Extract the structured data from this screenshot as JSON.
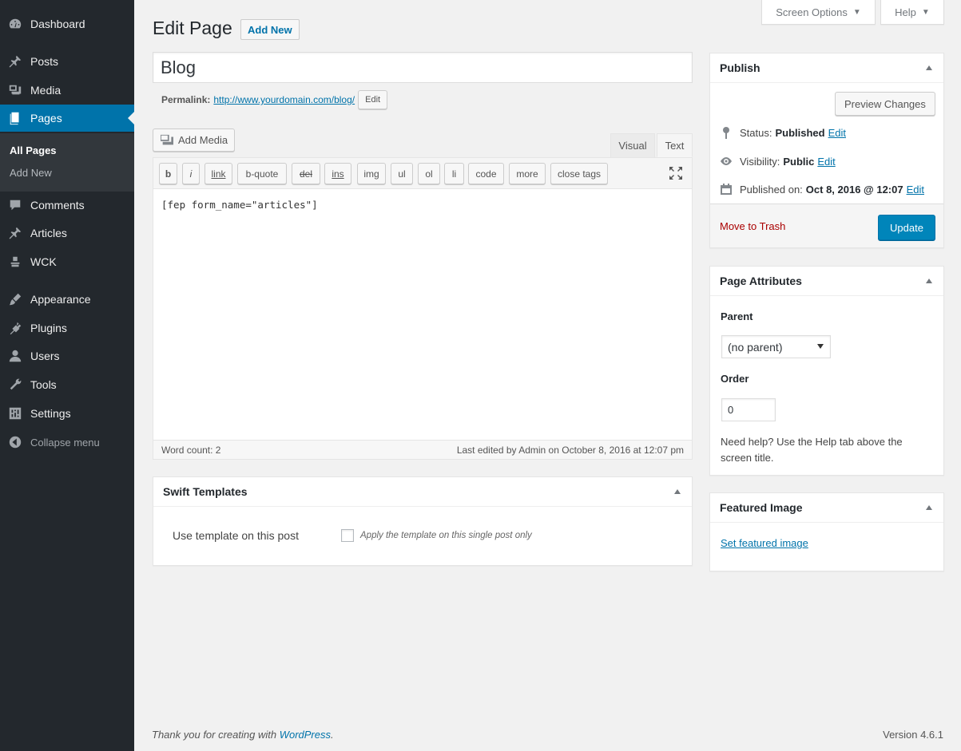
{
  "sidebar": {
    "items": [
      {
        "label": "Dashboard",
        "icon": "dashboard-icon"
      },
      {
        "label": "Posts",
        "icon": "pin-icon"
      },
      {
        "label": "Media",
        "icon": "media-icon"
      },
      {
        "label": "Pages",
        "icon": "pages-icon",
        "current": true
      },
      {
        "label": "Comments",
        "icon": "comment-icon"
      },
      {
        "label": "Articles",
        "icon": "pin-icon"
      },
      {
        "label": "WCK",
        "icon": "wck-icon"
      },
      {
        "label": "Appearance",
        "icon": "brush-icon"
      },
      {
        "label": "Plugins",
        "icon": "plugin-icon"
      },
      {
        "label": "Users",
        "icon": "user-icon"
      },
      {
        "label": "Tools",
        "icon": "wrench-icon"
      },
      {
        "label": "Settings",
        "icon": "settings-icon"
      }
    ],
    "submenu": [
      "All Pages",
      "Add New"
    ],
    "collapse_label": "Collapse menu"
  },
  "header": {
    "title": "Edit Page",
    "add_new": "Add New",
    "screen_options": "Screen Options",
    "help": "Help"
  },
  "post": {
    "title": "Blog",
    "permalink_label": "Permalink:",
    "permalink_url": "http://www.yourdomain.com/blog/",
    "permalink_edit": "Edit"
  },
  "editor": {
    "add_media": "Add Media",
    "tab_visual": "Visual",
    "tab_text": "Text",
    "quicktags": [
      "b",
      "i",
      "link",
      "b-quote",
      "del",
      "ins",
      "img",
      "ul",
      "ol",
      "li",
      "code",
      "more",
      "close tags"
    ],
    "content": "[fep form_name=\"articles\"]",
    "word_count": "Word count: 2",
    "last_edited": "Last edited by Admin on October 8, 2016 at 12:07 pm"
  },
  "publish": {
    "title": "Publish",
    "preview": "Preview Changes",
    "status_label": "Status:",
    "status_value": "Published",
    "visibility_label": "Visibility:",
    "visibility_value": "Public",
    "published_label": "Published on:",
    "published_value": "Oct 8, 2016 @ 12:07",
    "edit": "Edit",
    "trash": "Move to Trash",
    "update": "Update"
  },
  "attributes": {
    "title": "Page Attributes",
    "parent_label": "Parent",
    "parent_value": "(no parent)",
    "order_label": "Order",
    "order_value": "0",
    "help": "Need help? Use the Help tab above the screen title."
  },
  "featured": {
    "title": "Featured Image",
    "link": "Set featured image"
  },
  "swift": {
    "title": "Swift Templates",
    "label": "Use template on this post",
    "checkbox_desc": "Apply the template on this single post only"
  },
  "footer": {
    "thanks_prefix": "Thank you for creating with",
    "thanks_link": "WordPress",
    "thanks_suffix": ".",
    "version": "Version 4.6.1"
  },
  "colors": {
    "sidebar_bg": "#23282d",
    "accent": "#0073aa",
    "primary_button": "#0085ba",
    "trash": "#a00"
  }
}
